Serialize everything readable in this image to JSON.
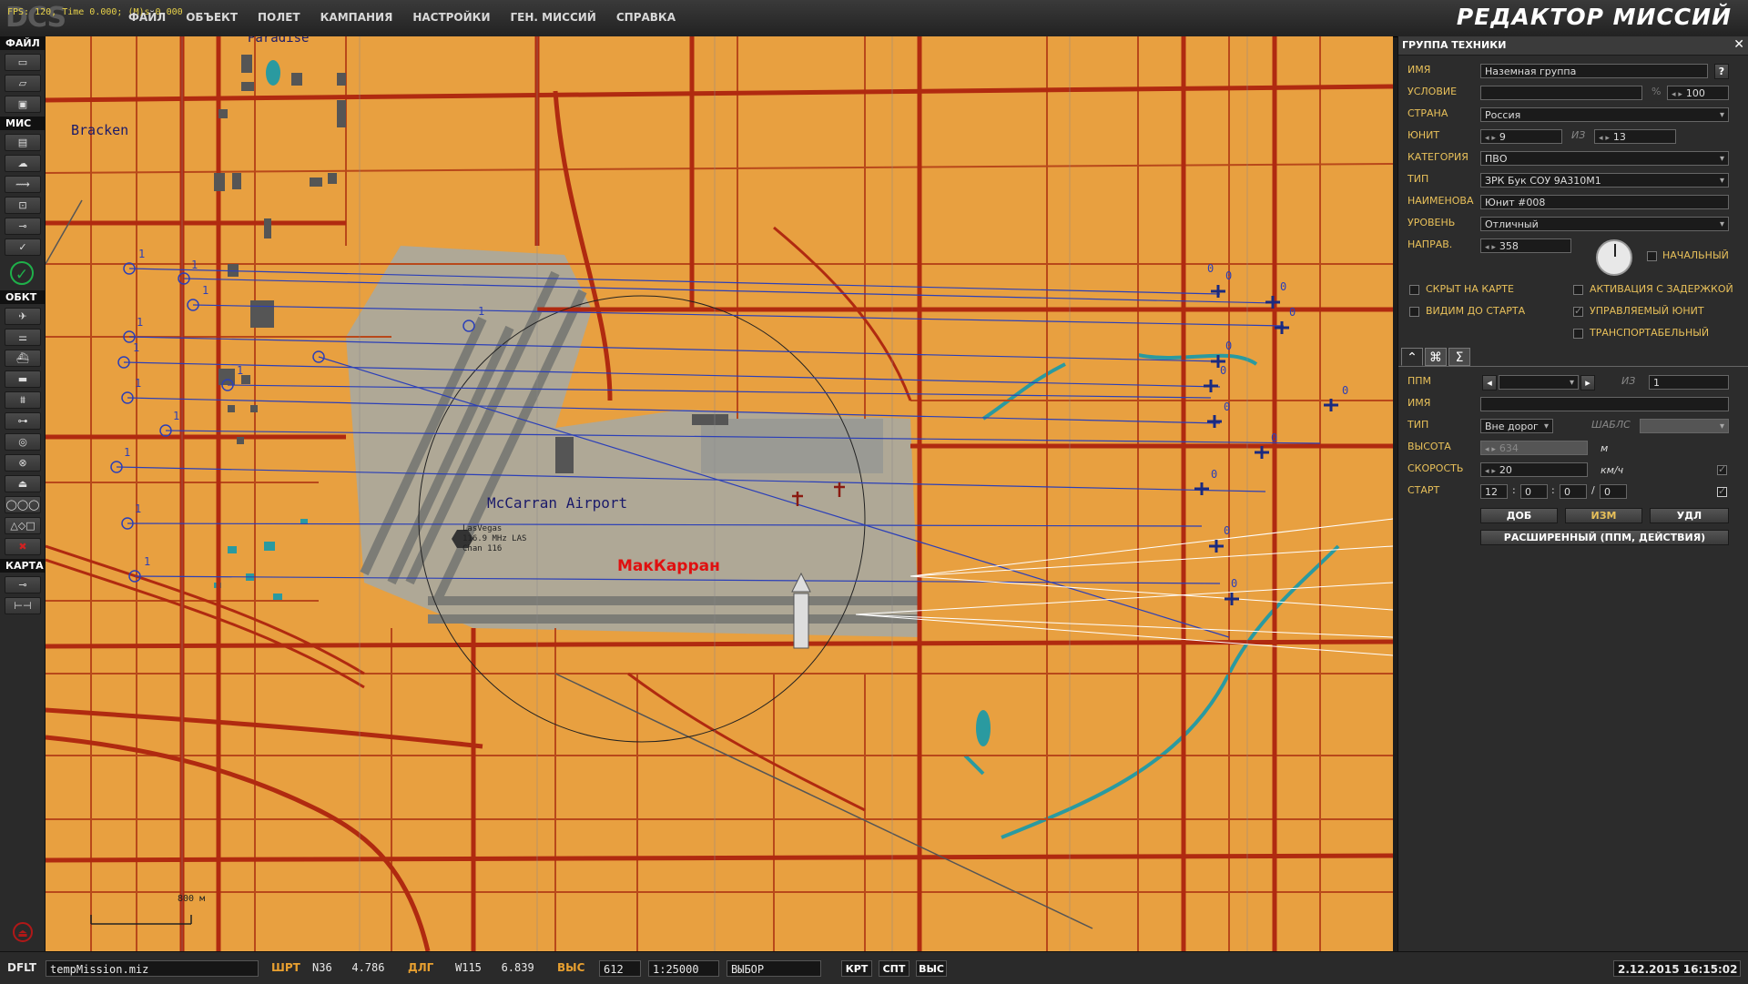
{
  "fps_text": "FPS: 120, Time 0.000; (M)s 0.000",
  "logo_text": "DCS",
  "menu": [
    "ФАЙЛ",
    "ОБЪЕКТ",
    "ПОЛЕТ",
    "КАМПАНИЯ",
    "НАСТРОЙКИ",
    "ГЕН. МИССИЙ",
    "СПРАВКА"
  ],
  "app_title": "РЕДАКТОР МИССИЙ",
  "toolbar": {
    "file": "ФАЙЛ",
    "mission": "МИС",
    "objects": "ОБКТ",
    "map": "КАРТА"
  },
  "map": {
    "labels": {
      "paradise": "Paradise",
      "bracken": "Bracken",
      "airport": "McCarran Airport",
      "ru_airport": "МакКарран",
      "nav_lines": [
        "LasVegas",
        "116.9 MHz LAS",
        "Chan 116"
      ],
      "scale": "800 м"
    },
    "waypoint_left": [
      "1",
      "1",
      "1",
      "1",
      "1",
      "1",
      "1",
      "1",
      "1",
      "1",
      "1",
      "1"
    ],
    "waypoint_right": [
      "0",
      "0",
      "0",
      "0",
      "0",
      "0",
      "0",
      "0",
      "0",
      "0",
      "0",
      "0"
    ],
    "colors": {
      "ground": "#e8a040",
      "road": "#b02a10",
      "airport": "#a8a8a0",
      "water": "#2a9aa0",
      "route": "#2b3fb8"
    }
  },
  "panel": {
    "title": "ГРУППА ТЕХНИКИ",
    "name_label": "ИМЯ",
    "name_value": "Наземная группа",
    "help": "?",
    "condition_label": "УСЛОВИЕ",
    "percent": "%",
    "condition_value": "100",
    "country_label": "СТРАНА",
    "country_value": "Россия",
    "unit_label": "ЮНИТ",
    "unit_value": "9",
    "of": "ИЗ",
    "unit_total": "13",
    "category_label": "КАТЕГОРИЯ",
    "category_value": "ПВО",
    "type_label": "ТИП",
    "type_value": "ЗРК Бук СОУ 9А310М1",
    "designation_label": "НАИМЕНОВА",
    "designation_value": "Юнит #008",
    "level_label": "УРОВЕНЬ",
    "level_value": "Отличный",
    "heading_label": "НАПРАВ.",
    "heading_value": "358",
    "initial_label": "НАЧАЛЬНЫЙ",
    "hidden_label": "СКРЫТ НА КАРТЕ",
    "delayed_label": "АКТИВАЦИЯ С ЗАДЕРЖКОЙ",
    "visible_label": "ВИДИМ ДО СТАРТА",
    "controlled_label": "УПРАВЛЯЕМЫЙ ЮНИТ",
    "transport_label": "ТРАНСПОРТАБЕЛЬНЫЙ",
    "tabs": [
      "route-icon",
      "actions-icon",
      "summary-icon"
    ],
    "tab_glyphs": [
      "⌃",
      "⌘",
      "Σ"
    ],
    "wp_label": "ППМ",
    "wp_of": "ИЗ",
    "wp_total": "1",
    "wp_name_label": "ИМЯ",
    "wp_type_label": "ТИП",
    "wp_type_value": "Вне дорог",
    "template_label": "ШАБЛС",
    "alt_label": "ВЫСОТА",
    "alt_value": "634",
    "alt_unit": "м",
    "speed_label": "СКОРОСТЬ",
    "speed_value": "20",
    "speed_unit": "км/ч",
    "start_label": "СТАРТ",
    "start_h": "12",
    "start_m": "0",
    "start_s": "0",
    "start_d": "0",
    "add_btn": "ДОБ",
    "edit_btn": "ИЗМ",
    "del_btn": "УДЛ",
    "adv_btn": "РАСШИРЕННЫЙ (ППМ, ДЕЙСТВИЯ)"
  },
  "status": {
    "profile": "DFLT",
    "file": "tempMission.miz",
    "lat_label": "ШРТ",
    "lat_value": "N36   4.786",
    "lon_label": "ДЛГ",
    "lon_value": "W115   6.839",
    "alt_label": "ВЫС",
    "alt_value": "612",
    "scale_value": "1:25000",
    "mode_value": "ВЫБОР",
    "btn_map": "КРТ",
    "btn_sat": "СПТ",
    "btn_alt": "ВЫС",
    "datetime": "2.12.2015 16:15:02"
  }
}
